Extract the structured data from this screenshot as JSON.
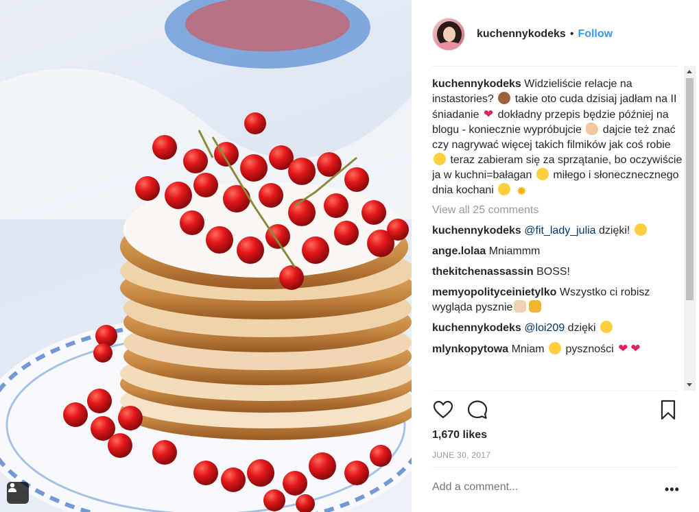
{
  "post": {
    "username": "kuchennykodeks",
    "separator": "•",
    "follow_label": "Follow",
    "caption": {
      "user": "kuchennykodeks",
      "segments": [
        {
          "t": "text",
          "v": "Widzieliście relacje na instastories? "
        },
        {
          "t": "emoji",
          "icon": "see-no-evil-monkey-emoji"
        },
        {
          "t": "text",
          "v": " takie oto cuda dzisiaj jadłam na II śniadanie "
        },
        {
          "t": "emoji",
          "icon": "heart-emoji"
        },
        {
          "t": "text",
          "v": " dokładny przepis będzie później na blogu - koniecznie wypróbujcie "
        },
        {
          "t": "emoji",
          "icon": "flexed-biceps-emoji"
        },
        {
          "t": "text",
          "v": " dajcie też znać czy nagrywać więcej takich filmików jak coś robie "
        },
        {
          "t": "emoji",
          "icon": "winking-kiss-emoji"
        },
        {
          "t": "text",
          "v": " teraz zabieram się za sprzątanie, bo oczywiście ja w kuchni=bałagan "
        },
        {
          "t": "emoji",
          "icon": "anxious-sweat-emoji"
        },
        {
          "t": "text",
          "v": " miłego i słonecznecznego dnia kochani "
        },
        {
          "t": "emoji",
          "icon": "winking-kiss-emoji"
        },
        {
          "t": "text",
          "v": " "
        },
        {
          "t": "emoji",
          "icon": "sun-emoji"
        }
      ]
    },
    "view_all_comments": "View all 25 comments",
    "comments": [
      {
        "user": "kuchennykodeks",
        "segments": [
          {
            "t": "mention",
            "v": "@fit_lady_julia"
          },
          {
            "t": "text",
            "v": " dzięki! "
          },
          {
            "t": "emoji",
            "icon": "winking-kiss-emoji"
          }
        ]
      },
      {
        "user": "ange.lolaa",
        "segments": [
          {
            "t": "text",
            "v": "Mniammm"
          }
        ]
      },
      {
        "user": "thekitchenassassin",
        "segments": [
          {
            "t": "text",
            "v": "BOSS!"
          }
        ]
      },
      {
        "user": "memyopolityceinietylko",
        "segments": [
          {
            "t": "text",
            "v": "Wszystko ci robisz wygląda pysznie"
          },
          {
            "t": "emoji",
            "icon": "clapping-hands-emoji"
          },
          {
            "t": "emoji",
            "icon": "thumbs-up-emoji"
          }
        ]
      },
      {
        "user": "kuchennykodeks",
        "segments": [
          {
            "t": "mention",
            "v": "@loi209"
          },
          {
            "t": "text",
            "v": " dzięki "
          },
          {
            "t": "emoji",
            "icon": "grinning-face-emoji"
          }
        ]
      },
      {
        "user": "mlynkopytowa",
        "segments": [
          {
            "t": "text",
            "v": "Mniam "
          },
          {
            "t": "emoji",
            "icon": "heart-eyes-emoji"
          },
          {
            "t": "text",
            "v": " pyszności "
          },
          {
            "t": "emoji",
            "icon": "heart-emoji"
          },
          {
            "t": "emoji",
            "icon": "heart-emoji"
          }
        ]
      }
    ],
    "likes": "1,670 likes",
    "date": "JUNE 30, 2017",
    "add_comment_placeholder": "Add a comment...",
    "more_label": "•••",
    "colors": {
      "link": "#3897f0",
      "mention": "#003569",
      "muted": "#999999",
      "heart": "#e0245e"
    }
  }
}
